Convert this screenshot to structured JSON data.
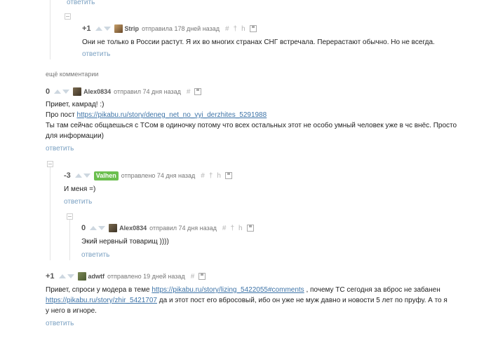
{
  "top_reply": "ответить",
  "more_comments": "ещё комментарии",
  "comments": [
    {
      "rating": "+1",
      "user": "Strip",
      "meta": "отправила 178 дней назад",
      "text": "Они не только в России растут. Я их во многих странах СНГ встречала. Перерастают обычно. Но не всегда.",
      "reply": "ответить"
    },
    {
      "rating": "0",
      "user": "Alex0834",
      "meta": "отправил 74 дня назад",
      "line1": "Привет, камрад! :)",
      "line2_prefix": "Про пост ",
      "line2_link": "https://pikabu.ru/story/deneg_net_no_vyi_derzhites_5291988",
      "line3": "Ты там сейчас общаешься с ТСом в одиночку потому что всех остальных этот не особо умный человек уже в чс внёс. Просто",
      "line4": "для информации)",
      "reply": "ответить"
    },
    {
      "rating": "-3",
      "user": "Valhen",
      "meta": "отправлено 74 дня назад",
      "text": "И меня =)",
      "reply": "ответить"
    },
    {
      "rating": "0",
      "user": "Alex0834",
      "meta": "отправил 74 дня назад",
      "text": "Экий нервный товарищ ))))",
      "reply": "ответить"
    },
    {
      "rating": "+1",
      "user": "adwtf",
      "meta": "отправлено 19 дней назад",
      "line1_prefix": "Привет, спроси у модера в теме ",
      "line1_link": "https://pikabu.ru/story/lizing_5422055#comments",
      "line1_suffix": " , почему ТС сегодня за вброс не забанен",
      "line2_link": "https://pikabu.ru/story/zhir_5421707",
      "line2_suffix": " да и этот пост его вбросовый, ибо он уже не муж давно и новости 5 лет по пруфу. А то я",
      "line3": "у него в игноре.",
      "reply": "ответить"
    }
  ],
  "tools": {
    "hash": "#",
    "pin": "†",
    "branch": "h"
  }
}
